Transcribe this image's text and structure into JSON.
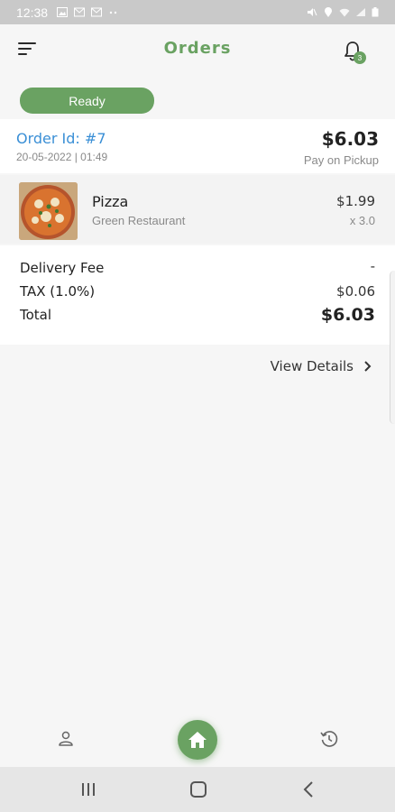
{
  "status_bar": {
    "time": "12:38",
    "icons_left": [
      "image-icon",
      "mail-icon",
      "mail-icon",
      "more-dots-icon"
    ],
    "icons_right": [
      "mute-icon",
      "location-icon",
      "wifi-icon",
      "signal-icon",
      "battery-icon"
    ]
  },
  "app_bar": {
    "title": "Orders",
    "notification_count": "3"
  },
  "order": {
    "status": "Ready",
    "id_label": "Order Id: #7",
    "date": "20-05-2022 | 01:49",
    "total": "$6.03",
    "payment_method": "Pay on Pickup",
    "items": [
      {
        "name": "Pizza",
        "restaurant": "Green Restaurant",
        "price": "$1.99",
        "quantity": "x 3.0"
      }
    ],
    "summary": {
      "delivery_fee_label": "Delivery Fee",
      "delivery_fee_value": "-",
      "tax_label": "TAX (1.0%)",
      "tax_value": "$0.06",
      "total_label": "Total",
      "total_value": "$6.03"
    },
    "view_details_label": "View Details"
  },
  "colors": {
    "accent": "#6aa262",
    "link": "#3a8fd6"
  },
  "bottom_nav": {
    "items": [
      "profile-icon",
      "home-icon",
      "history-icon"
    ]
  }
}
